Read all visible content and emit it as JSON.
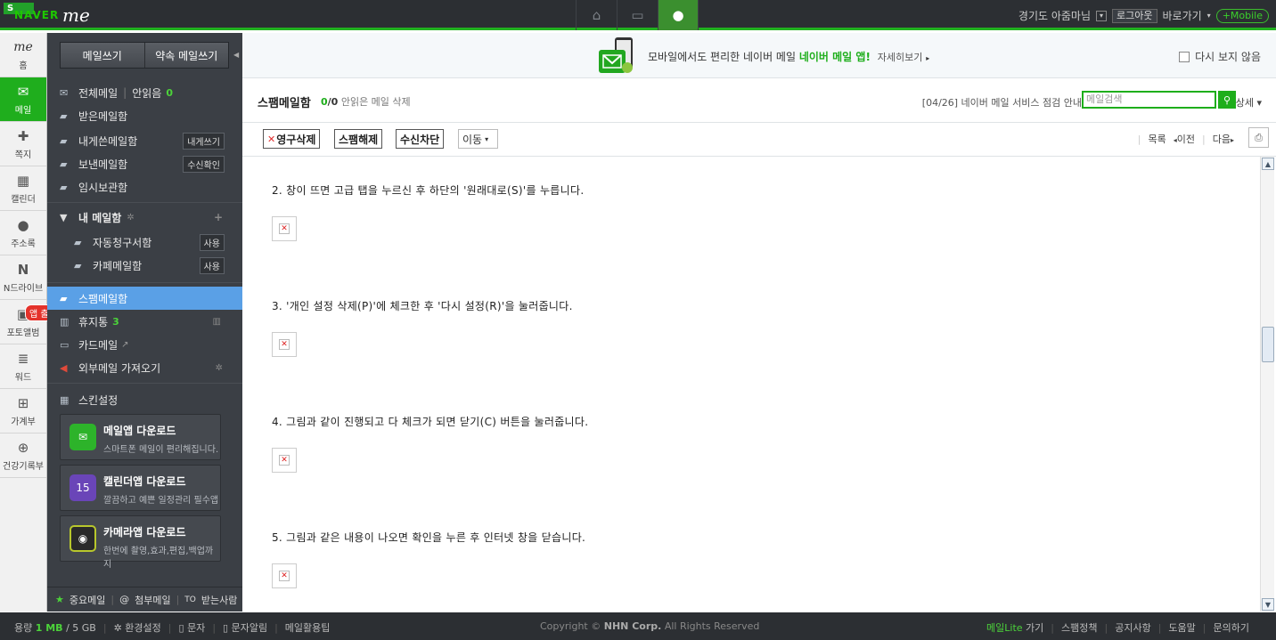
{
  "topbar": {
    "logo_badge": "S",
    "logo_naver": "NAVER",
    "logo_me": "me",
    "user_name": "경기도 아줌마님",
    "logout": "로그아웃",
    "shortcuts": "바로가기",
    "mobile": "+Mobile"
  },
  "rail": {
    "items": [
      {
        "label": "홈",
        "icon": "me-logo-icon"
      },
      {
        "label": "메일",
        "icon": "mail-icon"
      },
      {
        "label": "쪽지",
        "icon": "note-icon"
      },
      {
        "label": "캘린더",
        "icon": "calendar-icon"
      },
      {
        "label": "주소록",
        "icon": "contacts-icon"
      },
      {
        "label": "N드라이브",
        "icon": "ndrive-icon"
      },
      {
        "label": "포토앨범",
        "icon": "photo-album-icon"
      },
      {
        "label": "워드",
        "icon": "word-icon"
      },
      {
        "label": "가계부",
        "icon": "account-book-icon"
      },
      {
        "label": "건강기록부",
        "icon": "health-record-icon"
      }
    ],
    "launch_badge": "앱 출시"
  },
  "sidebar": {
    "compose": "메일쓰기",
    "compose_promise": "약속 메일쓰기",
    "all_mail": "전체메일",
    "unread_label": "안읽음",
    "unread_count": "0",
    "inbox": "받은메일함",
    "sent": "내게쓴메일함",
    "sent_tag": "내게쓰기",
    "outbox": "보낸메일함",
    "outbox_tag": "수신확인",
    "drafts": "임시보관함",
    "my_folders": "내 메일함",
    "auto_billing": "자동청구서함",
    "auto_billing_tag": "사용",
    "cafe": "카페메일함",
    "cafe_tag": "사용",
    "spam": "스팸메일함",
    "trash": "휴지통",
    "trash_count": "3",
    "card_mail": "카드메일",
    "external": "외부메일 가져오기",
    "skin": "스킨설정",
    "apps": [
      {
        "title": "메일앱 다운로드",
        "sub": "스마트폰 메일이 편리해집니다.",
        "color": "#2db32a"
      },
      {
        "title": "캘린더앱 다운로드",
        "sub": "깔끔하고 예쁜 일정관리 필수앱",
        "color": "#6a45b8"
      },
      {
        "title": "카메라앱 다운로드",
        "sub": "한번에 촬영,효과,편집,백업까지",
        "color": "#3a3a3a"
      }
    ],
    "bottom": {
      "important": "중요메일",
      "attach": "첨부메일",
      "to": "받는사람"
    }
  },
  "promo": {
    "text": "모바일에서도 편리한 네이버 메일",
    "highlight": "네이버 메일 앱!",
    "more": "자세히보기",
    "hide": "다시 보지 않음"
  },
  "mailbox": {
    "title": "스팸메일함",
    "count_unread": "0",
    "count_total": "/0",
    "delete_unread": "안읽은 메일 삭제",
    "notice": "[04/26] 네이버 메일 서비스 점검 안내",
    "search_placeholder": "메일검색",
    "detail": "상세"
  },
  "toolbar": {
    "delete": "영구삭제",
    "unspam": "스팸해제",
    "block": "수신차단",
    "move": "이동",
    "list": "목록",
    "prev": "이전",
    "next": "다음"
  },
  "content": {
    "steps": [
      "2. 창이 뜨면 고급 탭을 누르신 후 하단의 '원래대로(S)'를 누릅니다.",
      "3. '개인 설정 삭제(P)'에 체크한 후 '다시 설정(R)'을 눌러줍니다.",
      "4. 그림과 같이 진행되고 다 체크가 되면 닫기(C) 버튼을 눌러줍니다.",
      "5. 그림과 같은 내용이 나오면 확인을 누른 후 인터넷 창을 닫습니다."
    ]
  },
  "footer": {
    "usage_label": "용량",
    "usage_value": "1 MB",
    "usage_total": "/ 5 GB",
    "settings": "환경설정",
    "sms": "문자",
    "sms_alert": "문자알림",
    "tips": "메일활용팁",
    "copyright_pre": "Copyright ©",
    "copyright_corp": "NHN Corp.",
    "copyright_post": "All Rights Reserved",
    "lite": "메일Lite",
    "lite_go": "가기",
    "spam_policy": "스팸정책",
    "notices": "공지사항",
    "help": "도움말",
    "contact": "문의하기"
  },
  "colors": {
    "brand_green": "#1eae1b",
    "topbar": "#2c2f33",
    "sidebar": "#3b3f45",
    "selected": "#5aa0e6"
  }
}
